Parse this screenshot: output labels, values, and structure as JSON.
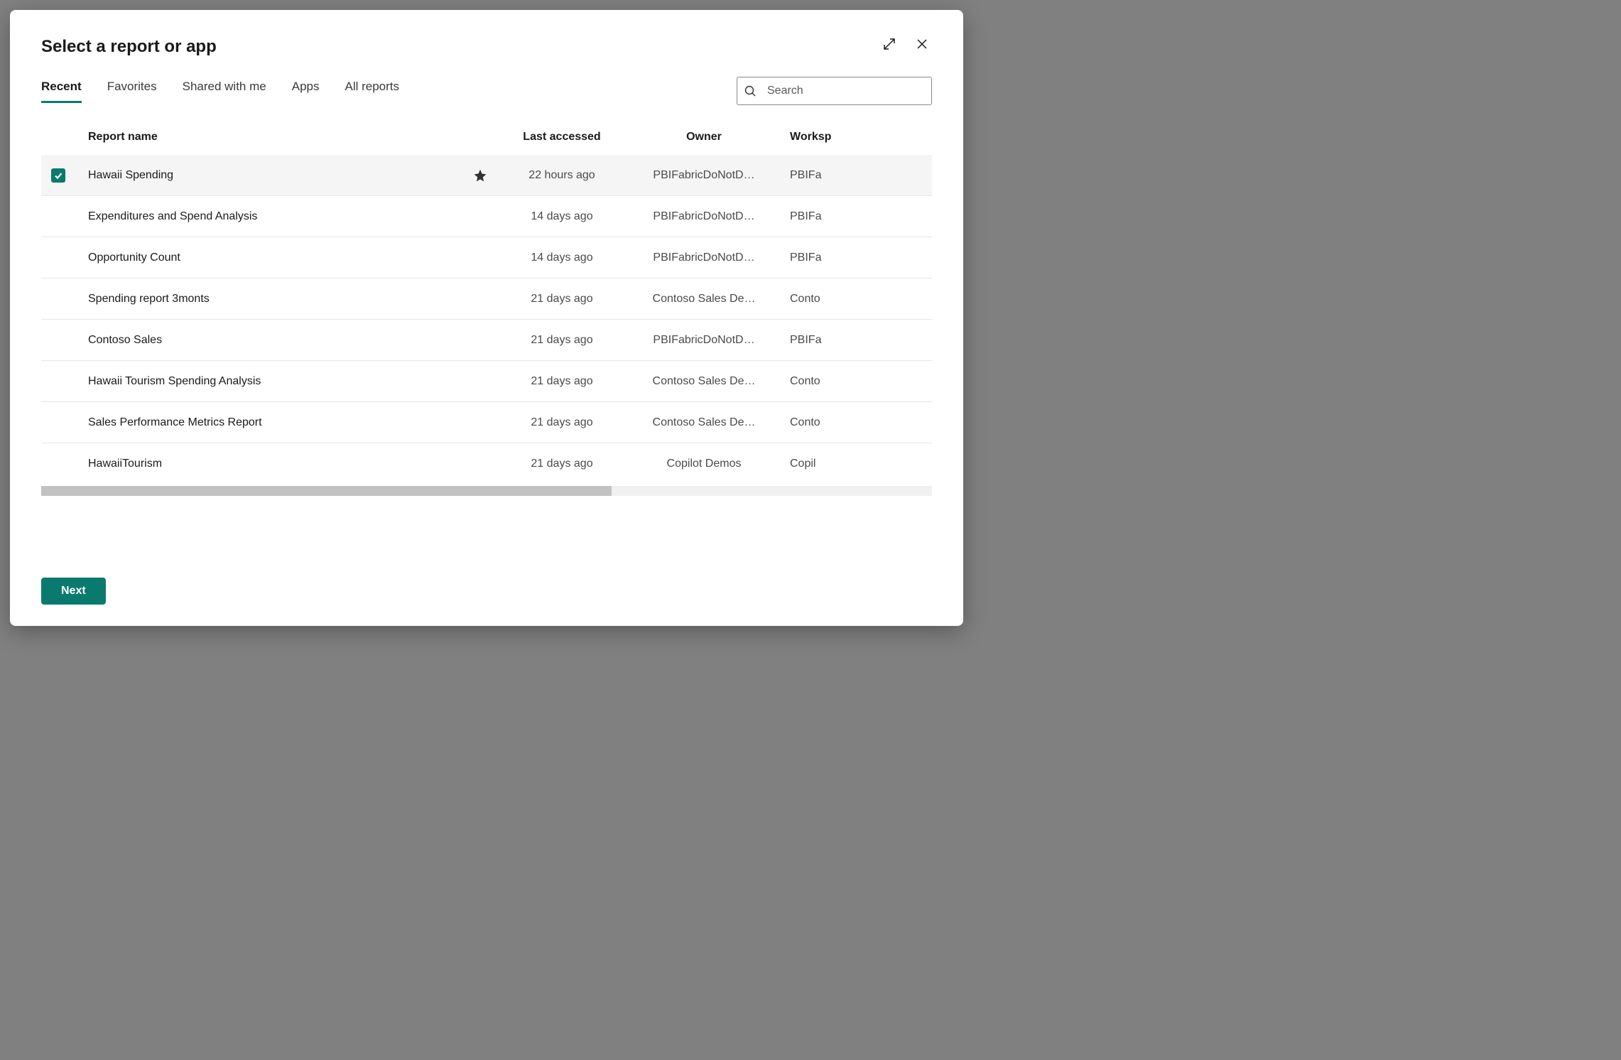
{
  "modal": {
    "title": "Select a report or app"
  },
  "tabs": {
    "items": [
      {
        "label": "Recent",
        "active": true
      },
      {
        "label": "Favorites",
        "active": false
      },
      {
        "label": "Shared with me",
        "active": false
      },
      {
        "label": "Apps",
        "active": false
      },
      {
        "label": "All reports",
        "active": false
      }
    ]
  },
  "search": {
    "placeholder": "Search"
  },
  "columns": {
    "name": "Report name",
    "access": "Last accessed",
    "owner": "Owner",
    "workspace": "Worksp"
  },
  "rows": [
    {
      "selected": true,
      "starred": true,
      "name": "Hawaii Spending",
      "access": "22 hours ago",
      "owner": "PBIFabricDoNotD…",
      "workspace": "PBIFa"
    },
    {
      "selected": false,
      "starred": false,
      "name": "Expenditures and Spend Analysis",
      "access": "14 days ago",
      "owner": "PBIFabricDoNotD…",
      "workspace": "PBIFa"
    },
    {
      "selected": false,
      "starred": false,
      "name": "Opportunity Count",
      "access": "14 days ago",
      "owner": "PBIFabricDoNotD…",
      "workspace": "PBIFa"
    },
    {
      "selected": false,
      "starred": false,
      "name": "Spending report 3monts",
      "access": "21 days ago",
      "owner": "Contoso Sales De…",
      "workspace": "Conto"
    },
    {
      "selected": false,
      "starred": false,
      "name": "Contoso Sales",
      "access": "21 days ago",
      "owner": "PBIFabricDoNotD…",
      "workspace": "PBIFa"
    },
    {
      "selected": false,
      "starred": false,
      "name": "Hawaii Tourism Spending Analysis",
      "access": "21 days ago",
      "owner": "Contoso Sales De…",
      "workspace": "Conto"
    },
    {
      "selected": false,
      "starred": false,
      "name": "Sales Performance Metrics Report",
      "access": "21 days ago",
      "owner": "Contoso Sales De…",
      "workspace": "Conto"
    },
    {
      "selected": false,
      "starred": false,
      "name": "HawaiiTourism",
      "access": "21 days ago",
      "owner": "Copilot Demos",
      "workspace": "Copil"
    }
  ],
  "footer": {
    "next": "Next"
  }
}
